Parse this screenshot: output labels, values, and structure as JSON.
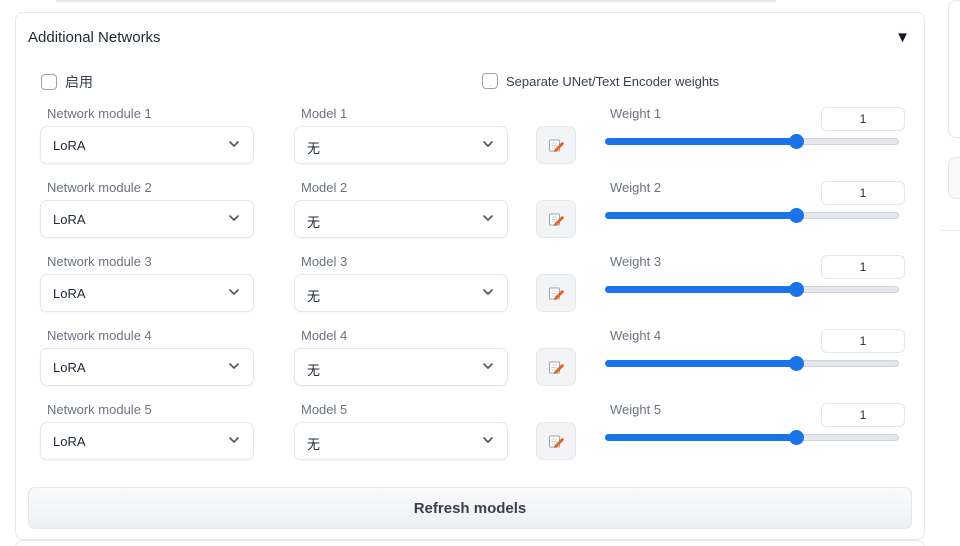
{
  "accordion": {
    "title": "Additional Networks",
    "toggle_symbol": "▼"
  },
  "enable": {
    "label": "启用",
    "checked": false
  },
  "separate_weights": {
    "label": "Separate UNet/Text Encoder weights",
    "checked": false
  },
  "rows": [
    {
      "module_label": "Network module 1",
      "module_value": "LoRA",
      "model_label": "Model 1",
      "model_value": "无",
      "weight_label": "Weight 1",
      "weight_value": "1",
      "slider_fraction": 0.65
    },
    {
      "module_label": "Network module 2",
      "module_value": "LoRA",
      "model_label": "Model 2",
      "model_value": "无",
      "weight_label": "Weight 2",
      "weight_value": "1",
      "slider_fraction": 0.65
    },
    {
      "module_label": "Network module 3",
      "module_value": "LoRA",
      "model_label": "Model 3",
      "model_value": "无",
      "weight_label": "Weight 3",
      "weight_value": "1",
      "slider_fraction": 0.65
    },
    {
      "module_label": "Network module 4",
      "module_value": "LoRA",
      "model_label": "Model 4",
      "model_value": "无",
      "weight_label": "Weight 4",
      "weight_value": "1",
      "slider_fraction": 0.65
    },
    {
      "module_label": "Network module 5",
      "module_value": "LoRA",
      "model_label": "Model 5",
      "model_value": "无",
      "weight_label": "Weight 5",
      "weight_value": "1",
      "slider_fraction": 0.65
    }
  ],
  "refresh_button": {
    "label": "Refresh models"
  },
  "colors": {
    "accent": "#1a73e8",
    "edit_icon_accent": "#f97316"
  },
  "icons": {
    "dropdown": "chevron-down-icon",
    "edit": "edit-pencil-icon"
  }
}
